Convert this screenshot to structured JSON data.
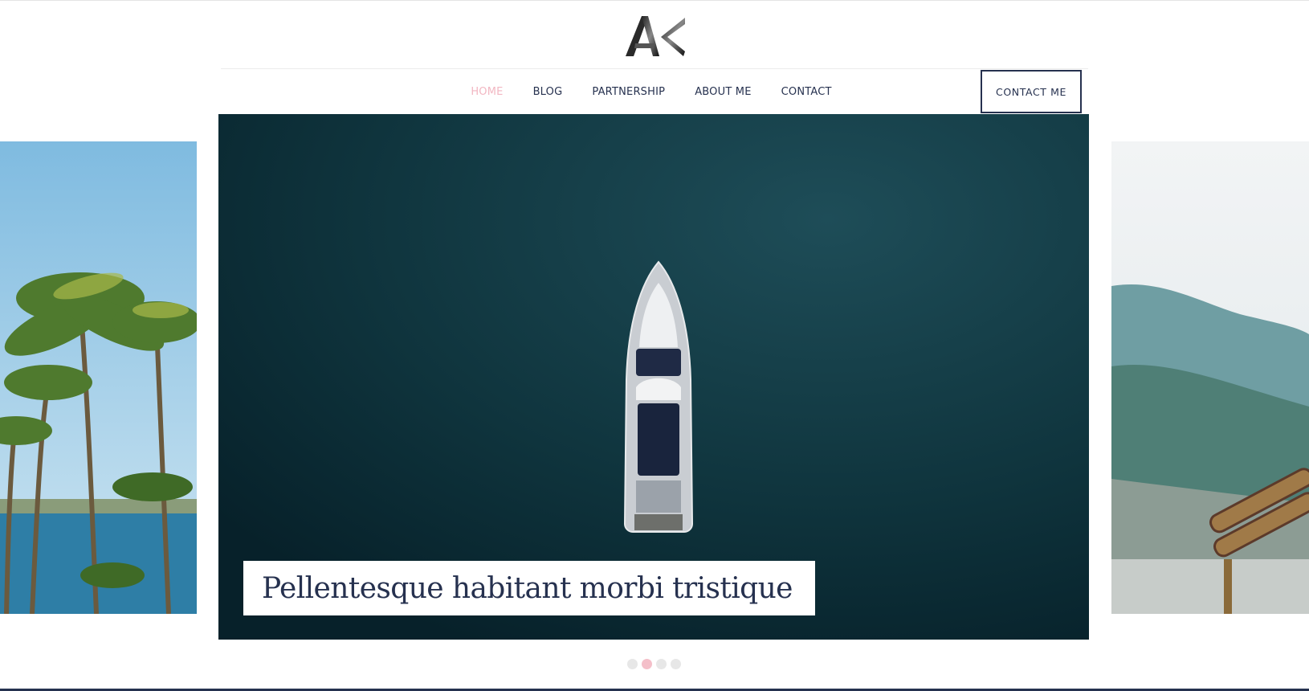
{
  "brand": {
    "logo_text": "AK"
  },
  "nav": {
    "items": [
      {
        "label": "HOME",
        "active": true
      },
      {
        "label": "BLOG",
        "active": false
      },
      {
        "label": "PARTNERSHIP",
        "active": false
      },
      {
        "label": "ABOUT ME",
        "active": false
      },
      {
        "label": "CONTACT",
        "active": false
      }
    ],
    "cta_label": "CONTACT ME"
  },
  "slider": {
    "slides": [
      {
        "image": "palm-trees-beach"
      },
      {
        "image": "yacht-aerial-sea",
        "caption": "Pellentesque habitant morbi tristique"
      },
      {
        "image": "misty-mountain-lake"
      }
    ],
    "dot_count": 4,
    "active_dot": 1
  },
  "colors": {
    "navy": "#26314f",
    "accent_pink": "#f2b7c2",
    "sea": "#0b2b33"
  }
}
